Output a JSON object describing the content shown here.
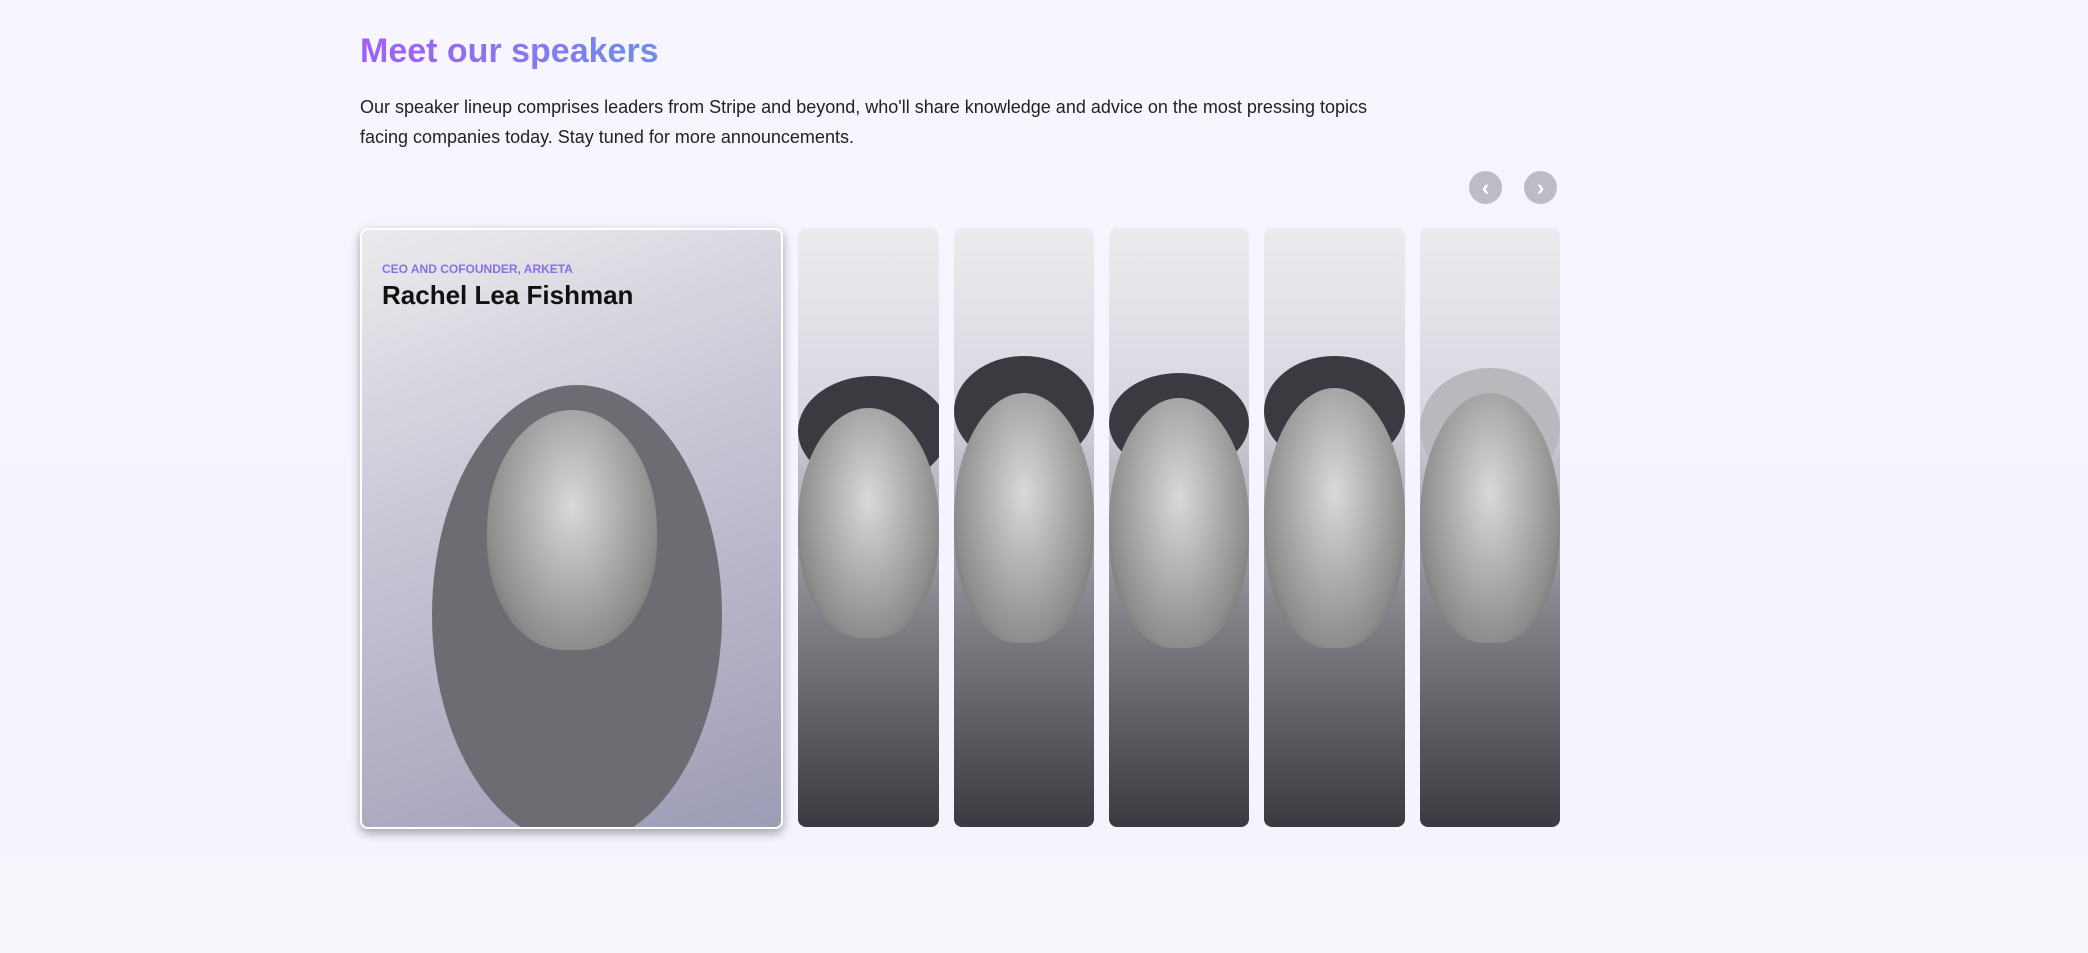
{
  "section": {
    "title": "Meet our speakers",
    "description": "Our speaker lineup comprises leaders from Stripe and beyond, who'll share knowledge and advice on the most pressing topics facing companies today. Stay tuned for more announcements."
  },
  "carousel": {
    "prev_icon": "chevron-left-icon",
    "next_icon": "chevron-right-icon",
    "prev_glyph": "‹",
    "next_glyph": "›",
    "active_speaker": {
      "role": "CEO AND COFOUNDER, ARKETA",
      "name": "Rachel Lea Fishman"
    }
  },
  "colors": {
    "accent_start": "#a35ef5",
    "accent_end": "#6f8ee8",
    "role": "#8a6fe8"
  }
}
